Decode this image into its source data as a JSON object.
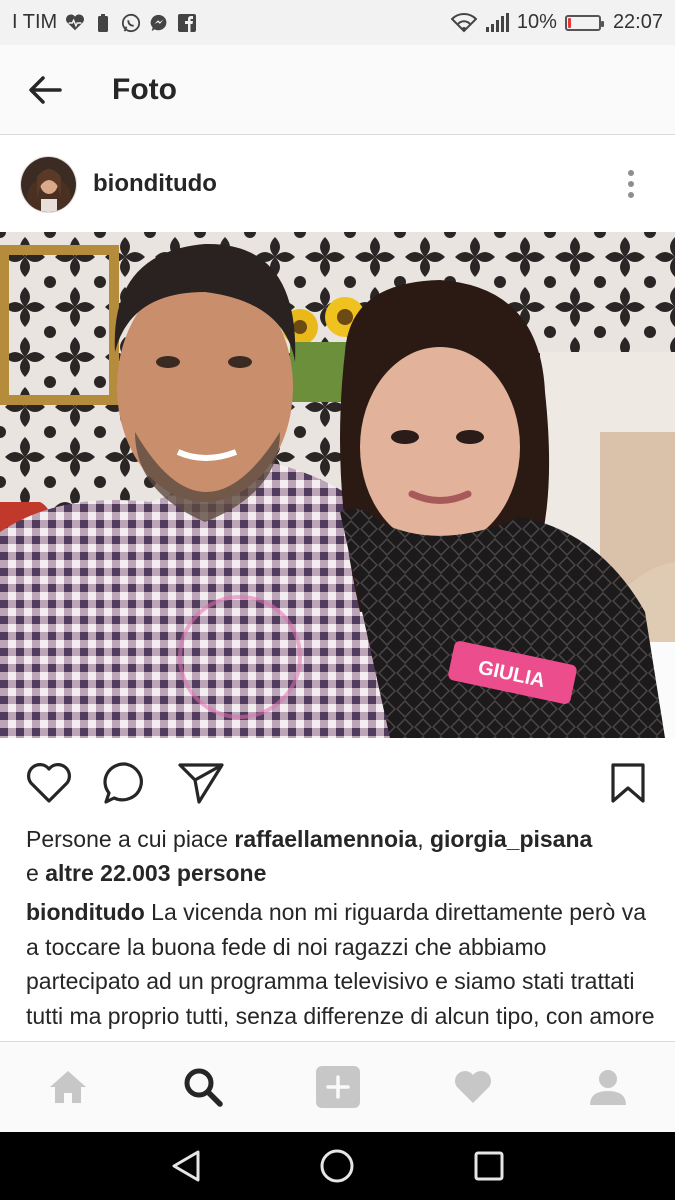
{
  "status_bar": {
    "carrier": "I TIM",
    "battery_percent_text": "10%",
    "battery_level": 0.1,
    "time": "22:07",
    "icons": [
      "heart-monitor-icon",
      "battery-saver-icon",
      "whatsapp-icon",
      "messenger-icon",
      "facebook-icon",
      "wifi-icon",
      "signal-icon",
      "battery-icon"
    ]
  },
  "header": {
    "title": "Foto",
    "back_icon": "arrow-left-icon"
  },
  "post": {
    "username": "bionditudo",
    "more_icon": "more-vertical-icon",
    "likes": {
      "prefix": "Persone a cui piace ",
      "user1": "raffaellamennoia",
      "separator": ", ",
      "user2": "giorgia_pisana",
      "conjunction": "e ",
      "others": "altre 22.003 persone"
    },
    "caption": {
      "author": "bionditudo",
      "text": " La vicenda non mi riguarda direttamente però va a toccare la buona fede di noi ragazzi che abbiamo partecipato ad un programma televisivo e siamo stati trattati tutti ma proprio tutti, senza differenze di alcun tipo, con amore e fedi. Quando"
    },
    "photo_overlay": {
      "name_tag": "GIULIA"
    }
  },
  "actions": {
    "like_icon": "heart-icon",
    "comment_icon": "comment-icon",
    "share_icon": "send-icon",
    "save_icon": "bookmark-icon"
  },
  "bottom_nav": {
    "items": [
      "home-icon",
      "search-icon",
      "add-icon",
      "activity-heart-icon",
      "profile-icon"
    ],
    "active": "search-icon"
  },
  "system_nav": {
    "items": [
      "back-triangle-icon",
      "home-circle-icon",
      "recents-square-icon"
    ]
  },
  "colors": {
    "text": "#262626",
    "inactive_icon": "#c7c7c7",
    "battery_low": "#e53935",
    "status_bar_bg": "#f2f2f2"
  }
}
